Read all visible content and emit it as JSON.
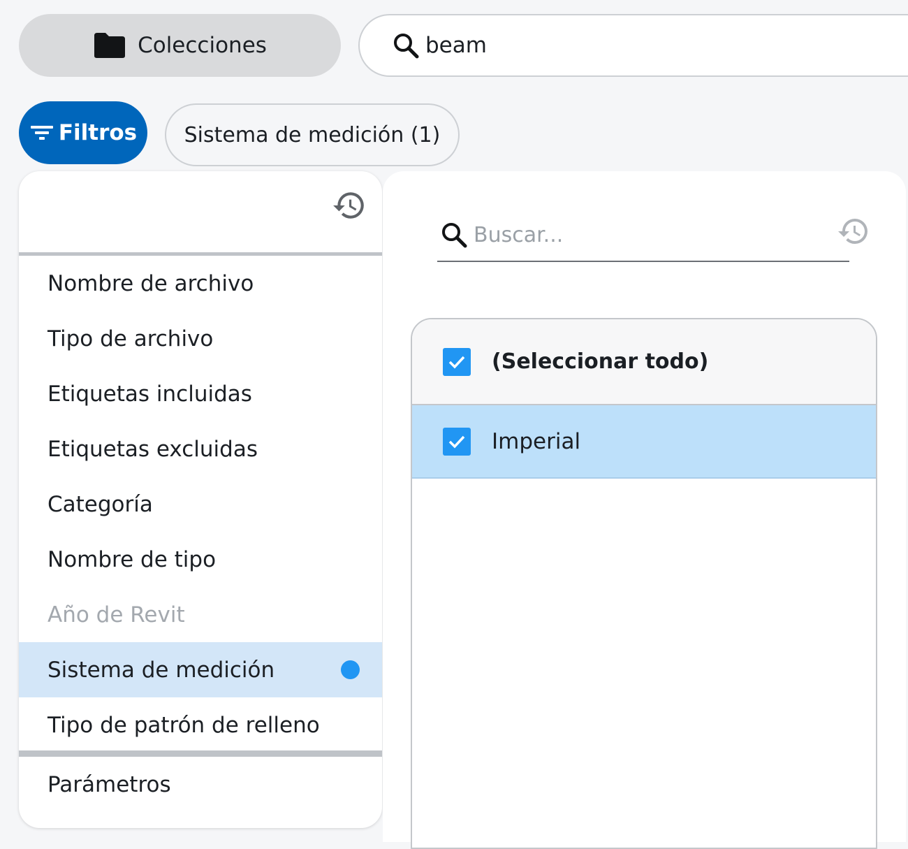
{
  "header": {
    "collections_label": "Colecciones",
    "search_value": "beam"
  },
  "filters_bar": {
    "filters_label": "Filtros",
    "active_chip_label": "Sistema de medición (1)"
  },
  "filter_categories": [
    {
      "label": "Nombre de archivo",
      "state": "normal"
    },
    {
      "label": "Tipo de archivo",
      "state": "normal"
    },
    {
      "label": "Etiquetas incluidas",
      "state": "normal"
    },
    {
      "label": "Etiquetas excluidas",
      "state": "normal"
    },
    {
      "label": "Categoría",
      "state": "normal"
    },
    {
      "label": "Nombre de tipo",
      "state": "normal"
    },
    {
      "label": "Año de Revit",
      "state": "disabled"
    },
    {
      "label": "Sistema de medición",
      "state": "active"
    },
    {
      "label": "Tipo de patrón de relleno",
      "state": "normal"
    }
  ],
  "parameters_label": "Parámetros",
  "options_panel": {
    "search_placeholder": "Buscar...",
    "select_all_label": "(Seleccionar todo)",
    "select_all_checked": true,
    "options": [
      {
        "label": "Imperial",
        "checked": true
      }
    ]
  },
  "colors": {
    "primary": "#0066bb",
    "active_background": "#d3e6f8",
    "checkbox": "#2196f3",
    "selected_option_background": "#bde0fa"
  }
}
